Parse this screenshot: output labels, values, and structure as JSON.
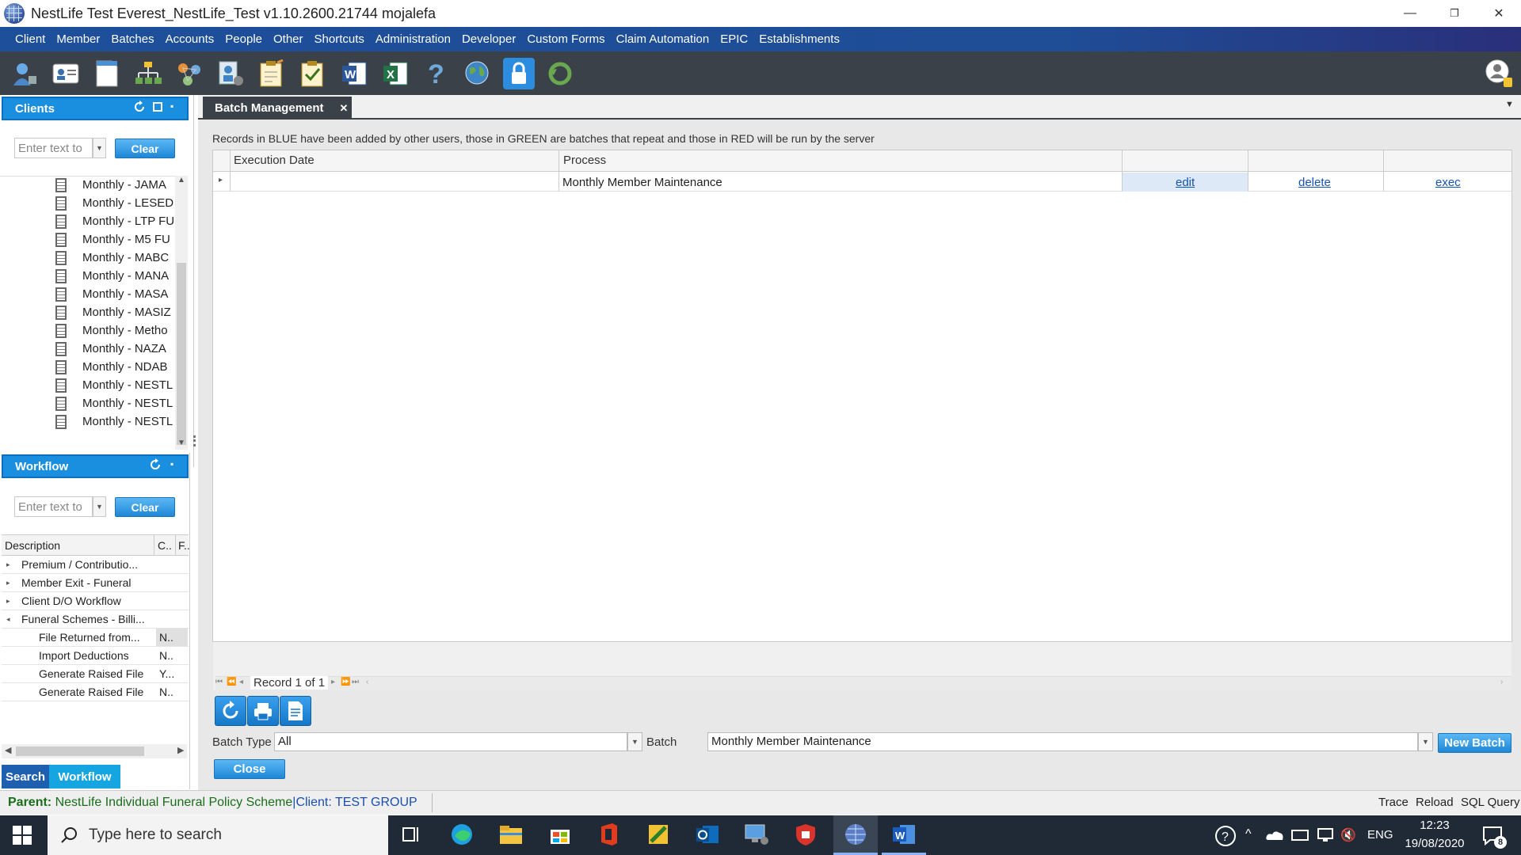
{
  "window": {
    "title": "NestLife Test Everest_NestLife_Test v1.10.2600.21744 mojalefa",
    "minimize": "—",
    "restore": "❐",
    "close": "✕"
  },
  "menu": [
    "Client",
    "Member",
    "Batches",
    "Accounts",
    "People",
    "Other",
    "Shortcuts",
    "Administration",
    "Developer",
    "Custom Forms",
    "Claim Automation",
    "EPIC",
    "Establishments"
  ],
  "toolbar_icons": [
    "user-manager-icon",
    "contact-card-icon",
    "document-icon",
    "org-chart-icon",
    "network-icon",
    "people-config-icon",
    "task-note-icon",
    "checklist-icon",
    "word-icon",
    "excel-icon",
    "help-icon",
    "globe-icon",
    "lock-icon",
    "refresh-green-icon"
  ],
  "clients_panel": {
    "title": "Clients",
    "search_placeholder": "Enter text to",
    "clear": "Clear",
    "items": [
      "Monthly - JAMA",
      "Monthly - LESED",
      "Monthly - LTP FU",
      "Monthly - M5 FU",
      "Monthly - MABC",
      "Monthly - MANA",
      "Monthly - MASA",
      "Monthly - MASIZ",
      "Monthly - Metho",
      "Monthly - NAZA",
      "Monthly - NDAB",
      "Monthly - NESTL",
      "Monthly - NESTL",
      "Monthly - NESTL"
    ]
  },
  "workflow_panel": {
    "title": "Workflow",
    "search_placeholder": "Enter text to",
    "clear": "Clear",
    "columns": [
      "Description",
      "C..",
      "F.."
    ],
    "rows": [
      {
        "expander": "▸",
        "desc": "Premium / Contributio...",
        "c": "",
        "indent": false
      },
      {
        "expander": "▸",
        "desc": "Member Exit - Funeral",
        "c": "",
        "indent": false
      },
      {
        "expander": "▸",
        "desc": "Client D/O Workflow",
        "c": "",
        "indent": false
      },
      {
        "expander": "◂",
        "desc": "Funeral Schemes - Billi...",
        "c": "",
        "indent": false
      },
      {
        "expander": "",
        "desc": "File Returned from...",
        "c": "N..",
        "indent": true
      },
      {
        "expander": "",
        "desc": "Import Deductions",
        "c": "N..",
        "indent": true
      },
      {
        "expander": "",
        "desc": "Generate Raised File",
        "c": "Y...",
        "indent": true
      },
      {
        "expander": "",
        "desc": "Generate Raised File",
        "c": "N..",
        "indent": true
      }
    ],
    "tabs": {
      "search": "Search",
      "workflow": "Workflow"
    }
  },
  "main": {
    "tab_title": "Batch Management",
    "tab_close": "✕",
    "notice": "Records in BLUE have been added by other users, those in GREEN are batches that repeat and those in RED will be run by the server",
    "columns": {
      "execution_date": "Execution Date",
      "process": "Process"
    },
    "rows": [
      {
        "execution_date": "",
        "process": "Monthly Member Maintenance",
        "edit": "edit",
        "delete": "delete",
        "exec": "exec"
      }
    ],
    "pager": "Record 1 of 1",
    "batch_type_label": "Batch Type",
    "batch_type_value": "All",
    "batch_label": "Batch",
    "batch_value": "Monthly Member Maintenance",
    "new_batch": "New Batch",
    "close": "Close"
  },
  "status": {
    "parent_label": "Parent:",
    "parent_value": "NestLife Individual Funeral Policy Scheme",
    "client_value": "|Client: TEST GROUP",
    "trace": "Trace",
    "reload": "Reload",
    "sql": "SQL Query"
  },
  "taskbar": {
    "search_placeholder": "Type here to search",
    "lang": "ENG",
    "time": "12:23",
    "date": "19/08/2020",
    "notif_count": "8"
  },
  "colors": {
    "accent": "#1a8fe0",
    "menu": "#1f4d96",
    "toolbar": "#3b4148",
    "taskbar": "#1f2a36",
    "link": "#1553b4"
  }
}
